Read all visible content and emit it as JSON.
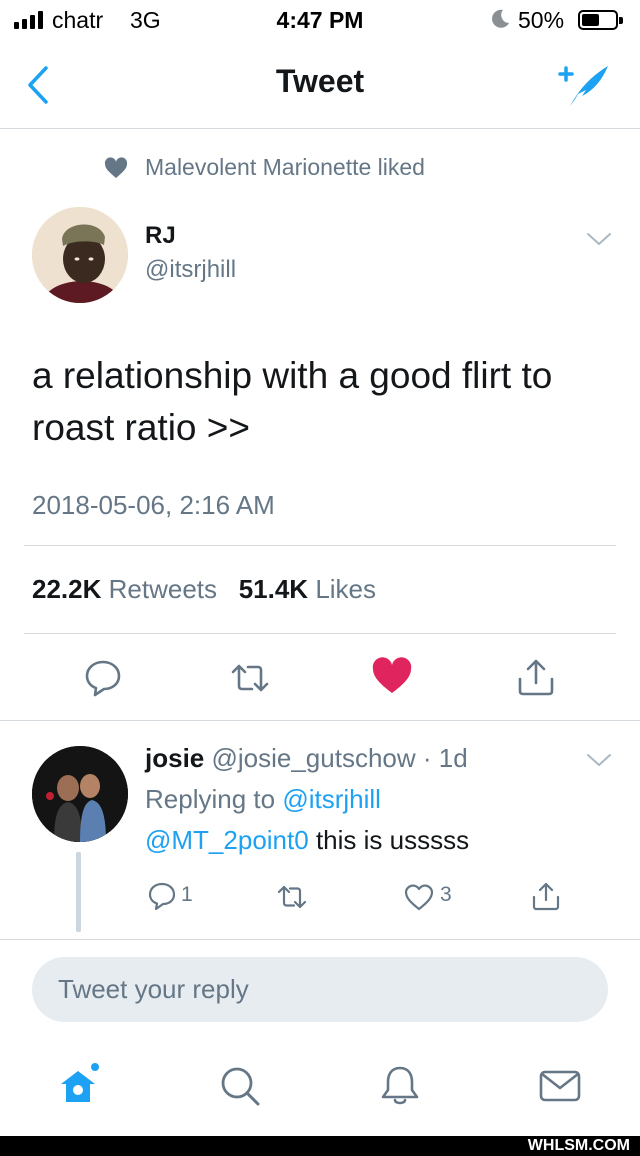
{
  "status_bar": {
    "carrier": "chatr",
    "network": "3G",
    "time": "4:47 PM",
    "battery_percent": "50%",
    "signal_icon": "signal-bars-icon",
    "battery_level": 0.5
  },
  "nav": {
    "title": "Tweet",
    "back_icon": "chevron-left-icon",
    "compose_icon": "compose-tweet-icon"
  },
  "social_context": {
    "icon": "heart-icon",
    "text": "Malevolent Marionette liked"
  },
  "tweet": {
    "author_name": "RJ",
    "author_handle": "@itsrjhill",
    "text_line1": "a relationship with a good flirt to",
    "text_line2": "roast ratio >>",
    "timestamp": "2018-05-06, 2:16 AM",
    "retweets_count": "22.2K",
    "retweets_label": "Retweets",
    "likes_count": "51.4K",
    "likes_label": "Likes",
    "liked": true
  },
  "reply": {
    "author_name": "josie",
    "author_handle": "@josie_gutschow",
    "time_ago": "· 1d",
    "replying_prefix": "Replying to",
    "replying_to": "@itsrjhill",
    "mention": "@MT_2point0",
    "text": "this is usssss",
    "reply_count": "1",
    "like_count": "3"
  },
  "composer": {
    "placeholder": "Tweet your reply"
  },
  "tab_bar": {
    "items": [
      "home-icon",
      "search-icon",
      "notifications-icon",
      "messages-icon"
    ]
  },
  "watermark": "WHLSM.COM",
  "colors": {
    "accent": "#1da1f2",
    "like": "#e0245e",
    "secondary_text": "#657786",
    "divider": "#d6dbe0"
  }
}
